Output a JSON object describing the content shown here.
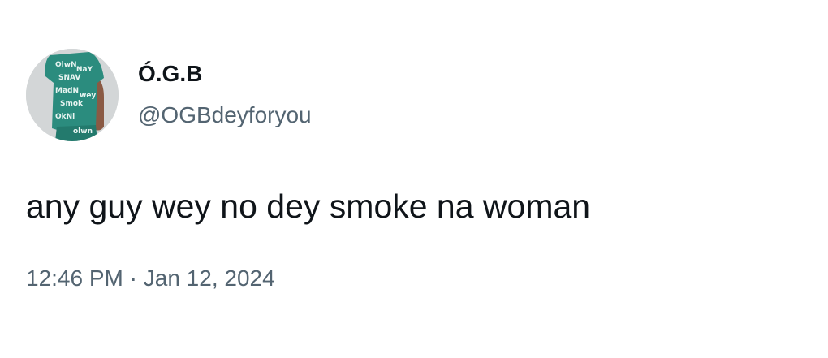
{
  "tweet": {
    "author": {
      "display_name": "Ó.G.B",
      "handle": "@OGBdeyforyou"
    },
    "text": "any guy wey no dey smoke na woman",
    "timestamp": {
      "time": "12:46 PM",
      "separator": "·",
      "date": "Jan 12, 2024"
    }
  },
  "colors": {
    "primary_text": "#0f1419",
    "secondary_text": "#536471",
    "background": "#ffffff",
    "avatar_shirt": "#2b8c7e"
  }
}
